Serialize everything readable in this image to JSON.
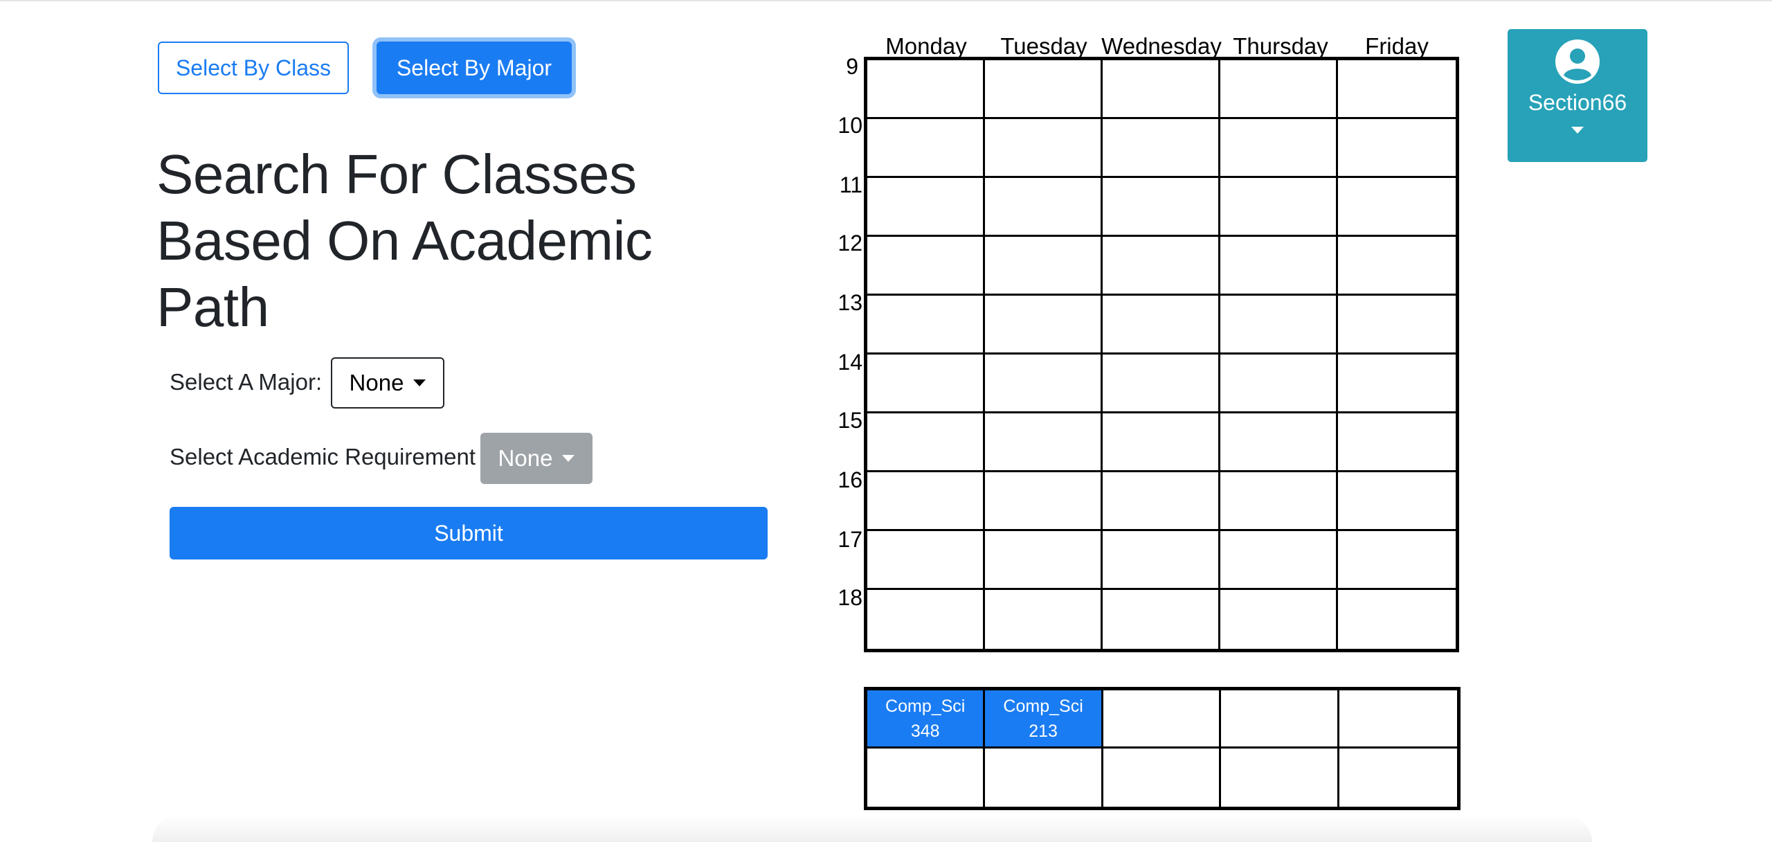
{
  "toggle": {
    "class_label": "Select By Class",
    "major_label": "Select By Major"
  },
  "search": {
    "title": "Search For Classes Based On Academic Path",
    "major_label": "Select A Major:",
    "major_value": "None",
    "requirement_label": "Select Academic Requirement",
    "requirement_value": "None",
    "submit_label": "Submit"
  },
  "schedule": {
    "days": [
      "Monday",
      "Tuesday",
      "Wednesday",
      "Thursday",
      "Friday"
    ],
    "hours": [
      "9",
      "10",
      "11",
      "12",
      "13",
      "14",
      "15",
      "16",
      "17",
      "18"
    ]
  },
  "selected_courses": [
    {
      "name": "Comp_Sci",
      "number": "348"
    },
    {
      "name": "Comp_Sci",
      "number": "213"
    }
  ],
  "user": {
    "name": "Section66"
  },
  "colors": {
    "primary": "#1a7cf2",
    "info": "#27a2b8",
    "disabled": "#9ea3a8"
  }
}
